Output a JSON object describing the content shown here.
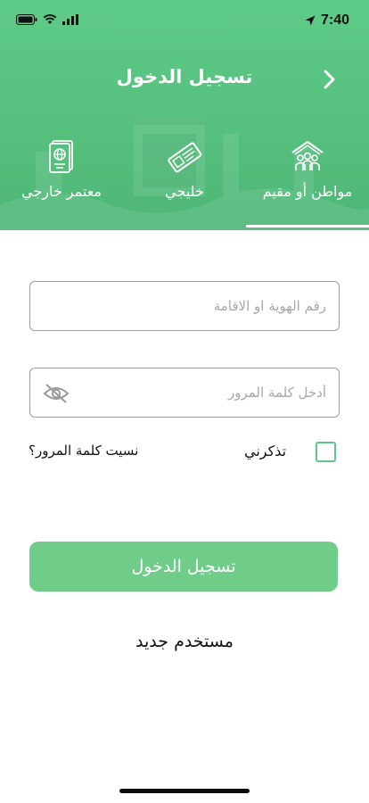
{
  "status_bar": {
    "time": "7:40",
    "left_icons": [
      "battery-icon",
      "wifi-icon",
      "signal-icon"
    ],
    "right_icons": [
      "location-arrow-icon"
    ]
  },
  "header": {
    "title": "تسجيل الدخول",
    "back_icon": "chevron-right-icon",
    "background_color": "#56c07e"
  },
  "tabs": [
    {
      "label": "مواطن أو مقيم",
      "icon": "family-home-icon",
      "selected": true
    },
    {
      "label": "خليجي",
      "icon": "gulf-id-card-icon",
      "selected": false
    },
    {
      "label": "معتمر خارجي",
      "icon": "passport-icon",
      "selected": false
    }
  ],
  "form": {
    "id_placeholder": "رقم الهوية او الاقامة",
    "password_placeholder": "أدخل كلمة المرور",
    "password_toggle_icon": "eye-off-icon",
    "remember_label": "تذكرني",
    "remember_checked": false,
    "forgot_label": "نسيت كلمة المرور؟",
    "submit_label": "تسجيل الدخول",
    "submit_color": "#6fcc89",
    "new_user_label": "مستخدم جديد"
  }
}
